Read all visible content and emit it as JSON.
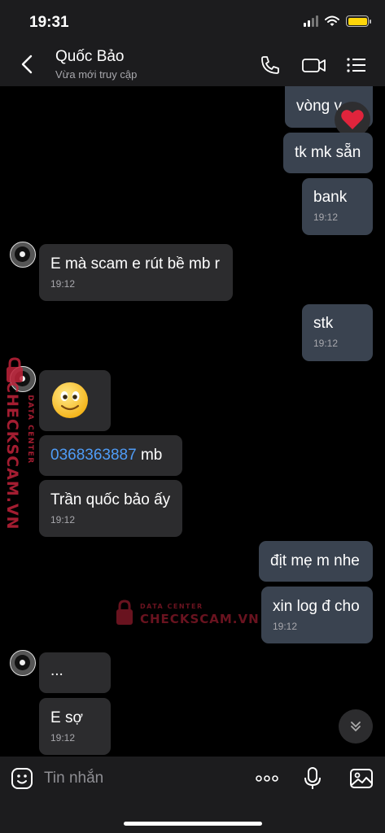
{
  "status_bar": {
    "time": "19:31"
  },
  "header": {
    "name": "Quốc Bảo",
    "status": "Vừa mới truy cập"
  },
  "messages": [
    {
      "text": "vòng v"
    },
    {
      "text": "tk mk sẵn"
    },
    {
      "text": "bank",
      "time": "19:12"
    },
    {
      "text": "E mà scam e rút bề mb r",
      "time": "19:12"
    },
    {
      "text": "stk",
      "time": "19:12"
    },
    {
      "emoji": "smiley"
    },
    {
      "link": "0368363887",
      "text": " mb"
    },
    {
      "text": "Trần quốc bảo ấy",
      "time": "19:12"
    },
    {
      "text": "địt mẹ m nhe"
    },
    {
      "text": "xin log đ cho",
      "time": "19:12"
    },
    {
      "text": "..."
    },
    {
      "text": "E sợ",
      "time": "19:12"
    }
  ],
  "watermark": {
    "top": "DATA CENTER",
    "brand": "CHECKSCAM.VN"
  },
  "input": {
    "placeholder": "Tin nhắn"
  },
  "colors": {
    "header_bg": "#1c1c1e",
    "incoming_bubble": "#2c2c2e",
    "outgoing_bubble": "#3a4350",
    "link": "#4f9cf7",
    "watermark": "#c0233a"
  },
  "icons": [
    "back-icon",
    "phone-icon",
    "video-icon",
    "menu-list-icon",
    "heart-reaction-icon",
    "chevron-down-icon",
    "sticker-icon",
    "more-icon",
    "microphone-icon",
    "image-icon"
  ]
}
